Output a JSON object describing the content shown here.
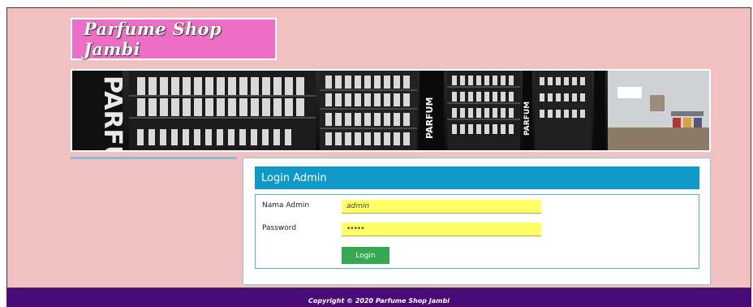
{
  "site": {
    "logo_text": "Parfume Shop Jambi"
  },
  "banner": {
    "image_name": "perfume-shop-shelves-image",
    "sign_text": "PARFUM"
  },
  "login": {
    "title": "Login Admin",
    "username_label": "Nama Admin",
    "username_value": "admin",
    "password_label": "Password",
    "password_value": "•••••",
    "button_label": "Login"
  },
  "footer": {
    "copyright": "Copyright © 2020 Parfume Shop Jambi"
  },
  "colors": {
    "page_background": "#f1c0c0",
    "logo_background": "#ee6dc5",
    "login_header": "#0f99c8",
    "input_background": "#ffff66",
    "button": "#34a853",
    "footer": "#4a0a78"
  }
}
